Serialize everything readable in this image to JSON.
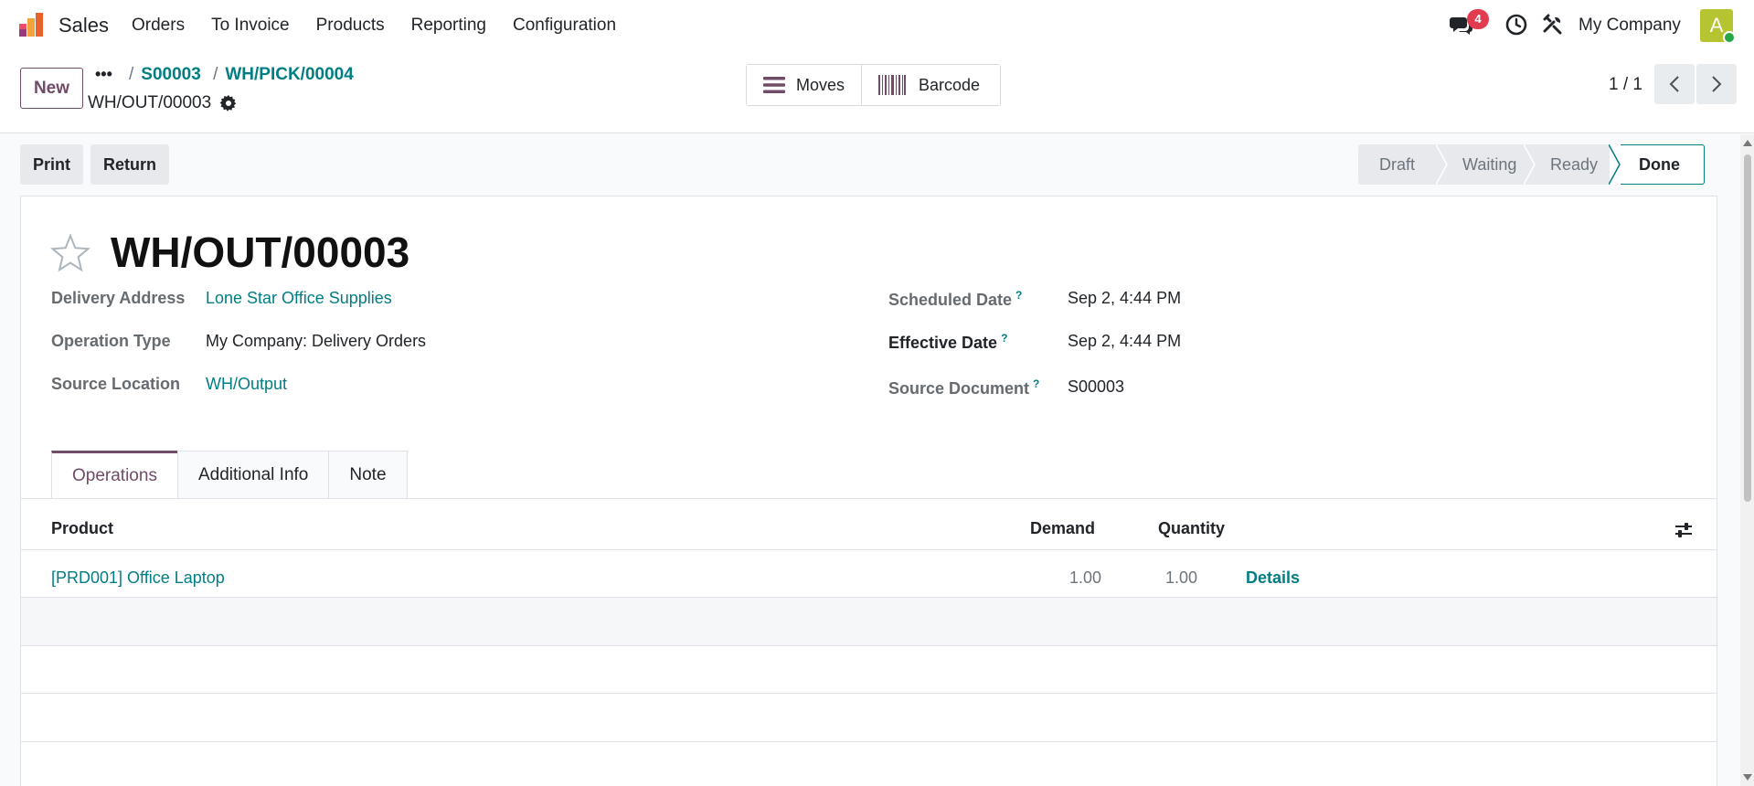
{
  "app": {
    "name": "Sales",
    "menu": [
      "Orders",
      "To Invoice",
      "Products",
      "Reporting",
      "Configuration"
    ],
    "notification_count": "4",
    "company": "My Company",
    "avatar_letter": "A"
  },
  "control_panel": {
    "new_label": "New",
    "more_label": "•••",
    "breadcrumbs": [
      "S00003",
      "WH/PICK/00004"
    ],
    "record_name": "WH/OUT/00003",
    "smart_buttons": [
      "Moves",
      "Barcode"
    ],
    "pager": "1 / 1"
  },
  "actions": {
    "print_label": "Print",
    "return_label": "Return"
  },
  "status": {
    "stages": [
      "Draft",
      "Waiting",
      "Ready",
      "Done"
    ],
    "current": "Done"
  },
  "record": {
    "title": "WH/OUT/00003",
    "left_fields": [
      {
        "label": "Delivery Address",
        "value": "Lone Star Office Supplies"
      },
      {
        "label": "Operation Type",
        "value": "My Company: Delivery Orders"
      },
      {
        "label": "Source Location",
        "value": "WH/Output"
      }
    ],
    "right_fields": [
      {
        "label": "Scheduled Date",
        "help": "?",
        "value": "Sep 2, 4:44 PM"
      },
      {
        "label": "Effective Date",
        "help": "?",
        "value": "Sep 2, 4:44 PM"
      },
      {
        "label": "Source Document",
        "help": "?",
        "value": "S00003"
      }
    ]
  },
  "tabs": [
    "Operations",
    "Additional Info",
    "Note"
  ],
  "operations": {
    "columns": [
      "Product",
      "Demand",
      "Quantity"
    ],
    "rows": [
      {
        "product": "[PRD001] Office Laptop",
        "demand": "1.00",
        "quantity": "1.00",
        "details_label": "Details"
      }
    ]
  },
  "colors": {
    "brand": "#714b67",
    "link": "#017e84",
    "badge": "#e23b4f",
    "done_border": "#017e84"
  }
}
